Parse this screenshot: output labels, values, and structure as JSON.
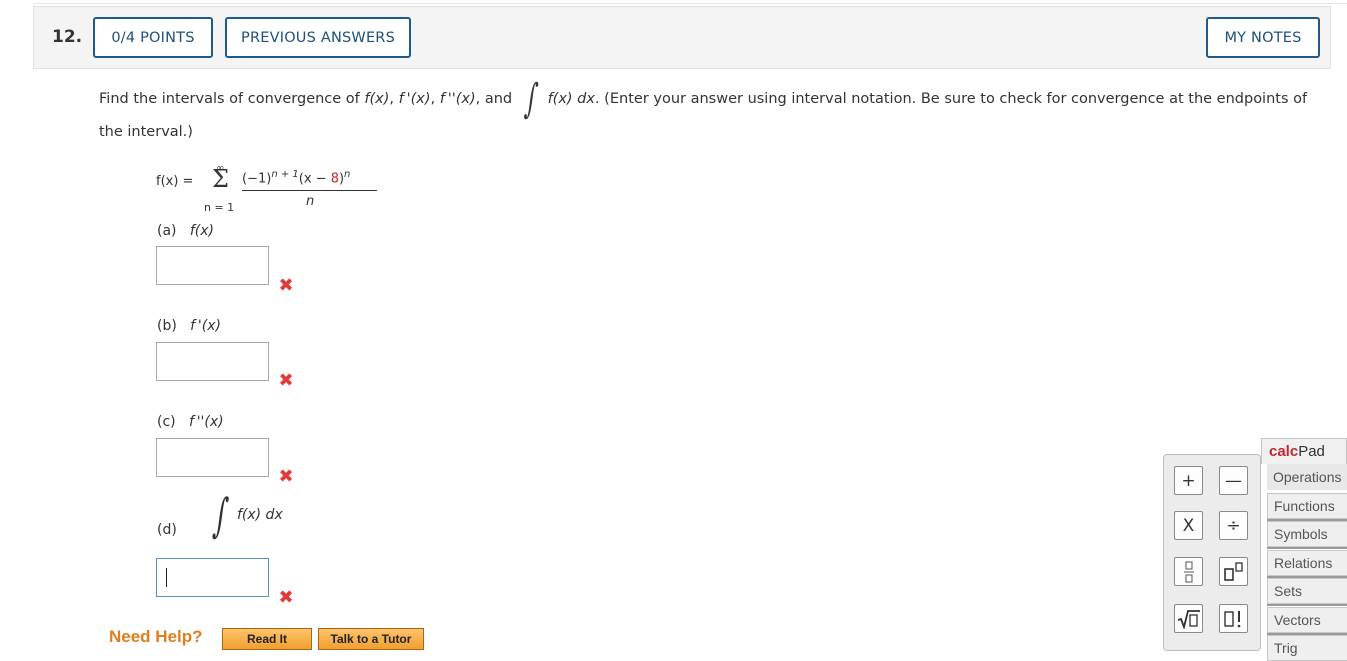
{
  "question": {
    "number": "12.",
    "points_label": "0/4 POINTS",
    "previous_answers_label": "PREVIOUS ANSWERS",
    "my_notes_label": "MY NOTES"
  },
  "prompt": {
    "part1": "Find the intervals of convergence of ",
    "fx": "f(x)",
    "sep1": ", ",
    "fpx": "f '(x)",
    "sep2": ", ",
    "fppx": "f ''(x)",
    "and": ", and ",
    "integrand": "f(x) dx",
    "part2": ". (Enter your answer using interval notation. Be sure to check for convergence at the endpoints of",
    "line2": "the interval.)"
  },
  "formula": {
    "lhs": "f(x) =",
    "upper": "∞",
    "sigma": "Σ",
    "lower": "n = 1",
    "num_a": "(−1)",
    "num_sup": "n + 1",
    "num_b": "(x − ",
    "num_red": "8",
    "num_c": ")",
    "num_sup2": "n",
    "den": "n"
  },
  "parts": [
    {
      "label": "(a)",
      "expr": "f(x)",
      "value": ""
    },
    {
      "label": "(b)",
      "expr": "f '(x)",
      "value": ""
    },
    {
      "label": "(c)",
      "expr": "f ''(x)",
      "value": ""
    },
    {
      "label": "(d)",
      "expr": "f(x) dx",
      "value": ""
    }
  ],
  "status": {
    "incorrect_icon": "x-mark-icon",
    "color": "#e03a3a"
  },
  "help": {
    "need_help": "Need Help?",
    "read_it": "Read It",
    "talk_tutor": "Talk to a Tutor"
  },
  "calcpad": {
    "title_calc": "calc",
    "title_pad": "Pad",
    "tabs": [
      "Operations",
      "Functions",
      "Symbols",
      "Relations",
      "Sets",
      "Vectors",
      "Trig"
    ],
    "keys": [
      "+",
      "—",
      "X",
      "÷",
      "▯/▯",
      "▯▯",
      "√▯",
      "▯!"
    ]
  }
}
